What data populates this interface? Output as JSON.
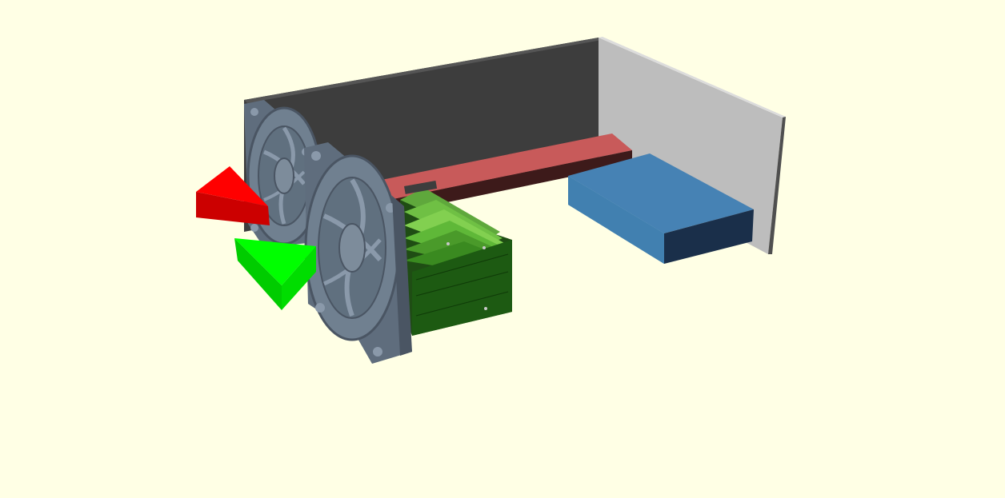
{
  "scene": {
    "background_color": "#ffffe5",
    "objects": [
      {
        "name": "back-wall-panel",
        "color": "#3d3d3d"
      },
      {
        "name": "side-wall-panel",
        "color": "#bdbdbd"
      },
      {
        "name": "red-support-bar",
        "color": "#c85a5a"
      },
      {
        "name": "blue-box",
        "color": "#4682b4"
      },
      {
        "name": "gpu-board-stack",
        "color": "#2d7a1e"
      },
      {
        "name": "fan-front",
        "color": "#708090"
      },
      {
        "name": "fan-rear",
        "color": "#708090"
      },
      {
        "name": "red-arrow-marker",
        "color": "#ff0000"
      },
      {
        "name": "green-arrow-marker",
        "color": "#00ff00"
      }
    ]
  }
}
